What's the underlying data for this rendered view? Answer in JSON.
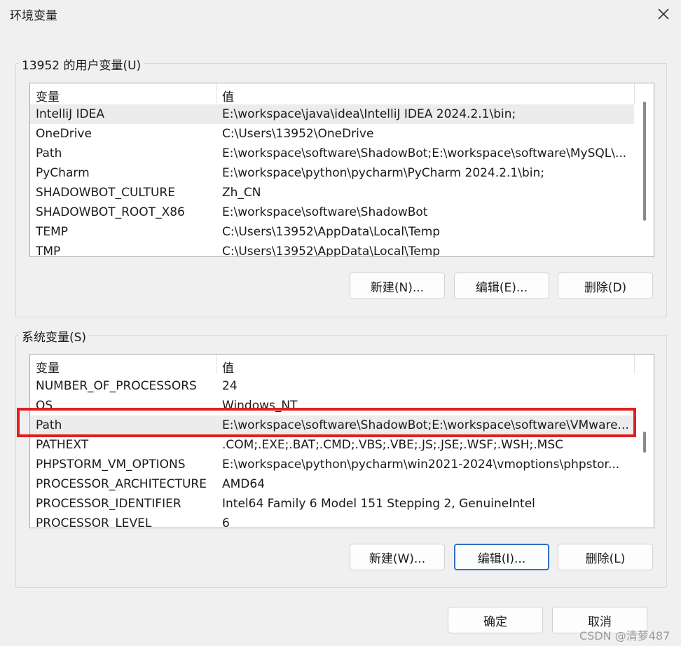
{
  "window": {
    "title": "环境变量"
  },
  "user_vars": {
    "label": "13952 的用户变量(U)",
    "header": {
      "name": "变量",
      "value": "值"
    },
    "rows": [
      {
        "name": "IntelliJ IDEA",
        "value": "E:\\workspace\\java\\idea\\IntelliJ IDEA 2024.2.1\\bin;"
      },
      {
        "name": "OneDrive",
        "value": "C:\\Users\\13952\\OneDrive"
      },
      {
        "name": "Path",
        "value": "E:\\workspace\\software\\ShadowBot;E:\\workspace\\software\\MySQL\\..."
      },
      {
        "name": "PyCharm",
        "value": "E:\\workspace\\python\\pycharm\\PyCharm 2024.2.1\\bin;"
      },
      {
        "name": "SHADOWBOT_CULTURE",
        "value": "Zh_CN"
      },
      {
        "name": "SHADOWBOT_ROOT_X86",
        "value": "E:\\workspace\\software\\ShadowBot"
      },
      {
        "name": "TEMP",
        "value": "C:\\Users\\13952\\AppData\\Local\\Temp"
      },
      {
        "name": "TMP",
        "value": "C:\\Users\\13952\\AppData\\Local\\Temp"
      }
    ],
    "buttons": {
      "new": "新建(N)...",
      "edit": "编辑(E)...",
      "delete": "删除(D)"
    }
  },
  "system_vars": {
    "label": "系统变量(S)",
    "header": {
      "name": "变量",
      "value": "值"
    },
    "rows": [
      {
        "name": "NUMBER_OF_PROCESSORS",
        "value": "24"
      },
      {
        "name": "OS",
        "value": "Windows_NT"
      },
      {
        "name": "Path",
        "value": "E:\\workspace\\software\\ShadowBot;E:\\workspace\\software\\VMware..."
      },
      {
        "name": "PATHEXT",
        "value": ".COM;.EXE;.BAT;.CMD;.VBS;.VBE;.JS;.JSE;.WSF;.WSH;.MSC"
      },
      {
        "name": "PHPSTORM_VM_OPTIONS",
        "value": "E:\\workspace\\python\\pycharm\\win2021-2024\\vmoptions\\phpstor..."
      },
      {
        "name": "PROCESSOR_ARCHITECTURE",
        "value": "AMD64"
      },
      {
        "name": "PROCESSOR_IDENTIFIER",
        "value": "Intel64 Family 6 Model 151 Stepping 2, GenuineIntel"
      },
      {
        "name": "PROCESSOR_LEVEL",
        "value": "6"
      }
    ],
    "buttons": {
      "new": "新建(W)...",
      "edit": "编辑(I)...",
      "delete": "删除(L)"
    }
  },
  "footer": {
    "ok": "确定",
    "cancel": "取消"
  },
  "watermark": "CSDN @清萝487",
  "icons": {
    "close": "close-icon"
  },
  "colors": {
    "highlight": "#e02020",
    "focus_border": "#2f6fc0"
  }
}
